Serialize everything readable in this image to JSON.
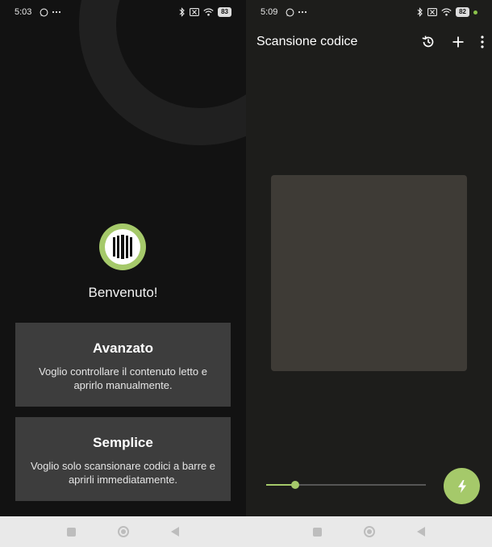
{
  "left_screen": {
    "status": {
      "time": "5:03",
      "battery": "83"
    },
    "welcome": "Benvenuto!",
    "options": [
      {
        "title": "Avanzato",
        "description": "Voglio controllare il contenuto letto e aprirlo manualmente."
      },
      {
        "title": "Semplice",
        "description": "Voglio solo scansionare codici a barre e aprirli immediatamente."
      }
    ]
  },
  "right_screen": {
    "status": {
      "time": "5:09",
      "battery": "82"
    },
    "title": "Scansione codice",
    "zoom_level": 0.18
  },
  "colors": {
    "accent": "#a5c96a",
    "left_bg": "#121212",
    "right_bg": "#1d1d1b",
    "card_bg": "#3d3d3d",
    "scan_box": "#3e3b36",
    "nav_bar": "#e9e9e9"
  },
  "icons": [
    "whatsapp-icon",
    "more-horiz-icon",
    "bluetooth-icon",
    "no-sim-icon",
    "wifi-icon",
    "battery-icon",
    "history-icon",
    "add-icon",
    "more-vert-icon",
    "flash-icon",
    "barcode-icon",
    "nav-recents-icon",
    "nav-home-icon",
    "nav-back-icon"
  ]
}
